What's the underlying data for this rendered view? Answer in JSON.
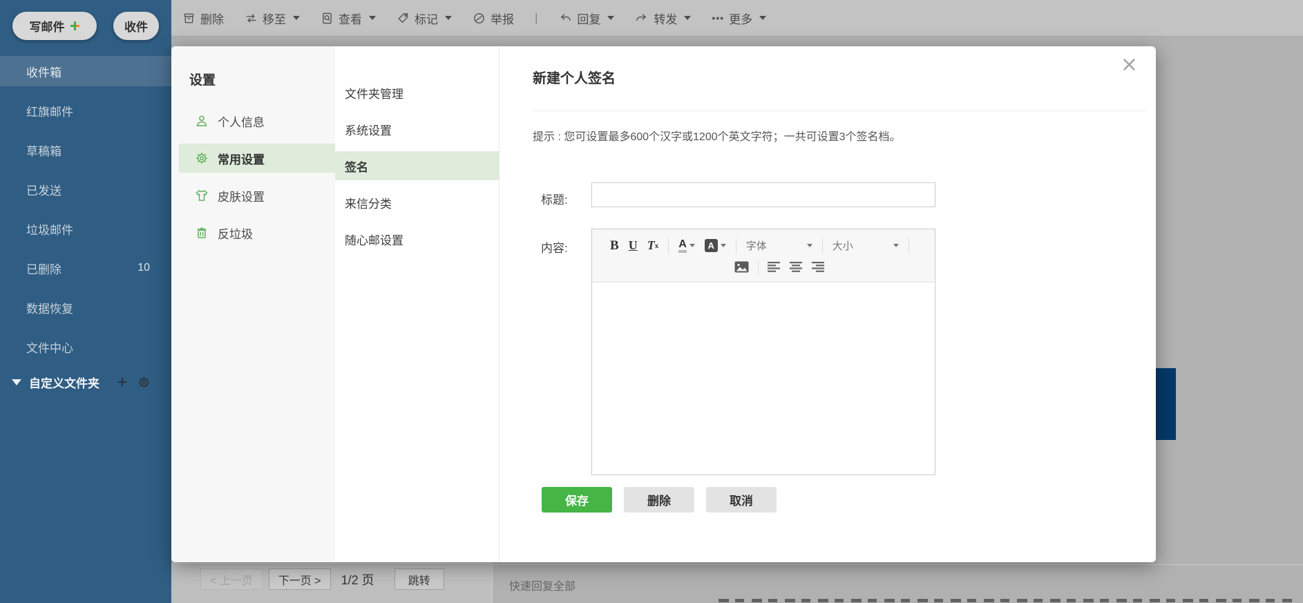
{
  "app": {
    "compose": {
      "write_label": "写邮件",
      "receive_label": "收件",
      "plus": "+"
    },
    "toolbar": {
      "items": [
        {
          "label": "删除"
        },
        {
          "label": "移至"
        },
        {
          "label": "查看"
        },
        {
          "label": "标记"
        },
        {
          "label": "举报"
        },
        {
          "label": "回复"
        },
        {
          "label": "转发"
        },
        {
          "label": "更多",
          "prefix": "•••"
        }
      ],
      "divider": "|"
    },
    "sidebar": {
      "items": [
        {
          "label": "收件箱"
        },
        {
          "label": "红旗邮件"
        },
        {
          "label": "草稿箱"
        },
        {
          "label": "已发送"
        },
        {
          "label": "垃圾邮件"
        },
        {
          "label": "已删除",
          "count": "10"
        },
        {
          "label": "数据恢复"
        },
        {
          "label": "文件中心"
        }
      ],
      "custom_folder_label": "自定义文件夹",
      "add_label": "+"
    },
    "list_pane": {
      "pagination": {
        "prev": "< 上一页",
        "next": "下一页 >",
        "page": "1/2 页",
        "jump": "跳转"
      }
    },
    "reading_pane": {
      "quick_reply": "快速回复全部"
    }
  },
  "settings": {
    "title": "设置",
    "nav": [
      {
        "label": "个人信息"
      },
      {
        "label": "常用设置"
      },
      {
        "label": "皮肤设置"
      },
      {
        "label": "反垃圾"
      }
    ],
    "subnav": [
      {
        "label": "文件夹管理"
      },
      {
        "label": "系统设置"
      },
      {
        "label": "签名"
      },
      {
        "label": "来信分类"
      },
      {
        "label": "随心邮设置"
      }
    ]
  },
  "dialog": {
    "title": "新建个人签名",
    "close": "×",
    "hint": "提示 : 您可设置最多600个汉字或1200个英文字符；一共可设置3个签名档。",
    "form": {
      "title_label": "标题:",
      "content_label": "内容:",
      "title_value": "",
      "editor": {
        "bold": "B",
        "underline": "U",
        "clear_t": "T",
        "clear_x": "x",
        "color_a": "A",
        "bgcolor_a": "A",
        "font_placeholder": "字体",
        "size_placeholder": "大小"
      }
    },
    "buttons": {
      "save": "保存",
      "delete": "删除",
      "cancel": "取消"
    }
  },
  "colors": {
    "accent_green": "#45b545",
    "highlight_green": "#dfecdb",
    "sidebar_blue": "#2f5d83",
    "banner_blue": "#05396b"
  }
}
